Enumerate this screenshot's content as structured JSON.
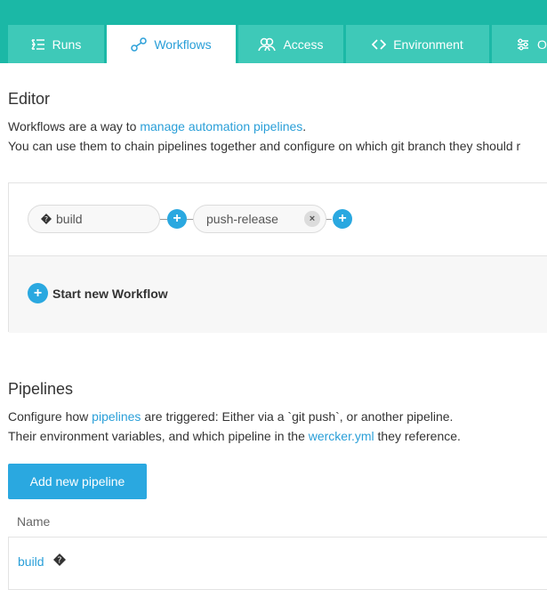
{
  "tabs": [
    {
      "label": "Runs",
      "icon": "runs-icon"
    },
    {
      "label": "Workflows",
      "icon": "workflows-icon",
      "active": true
    },
    {
      "label": "Access",
      "icon": "access-icon"
    },
    {
      "label": "Environment",
      "icon": "code-icon"
    },
    {
      "label": "O",
      "icon": "options-icon"
    }
  ],
  "editor": {
    "title": "Editor",
    "desc1_prefix": "Workflows are a way to ",
    "desc1_link": "manage automation pipelines",
    "desc1_suffix": ".",
    "desc2": "You can use them to chain pipelines together and configure on which git branch they should r"
  },
  "workflow": {
    "nodes": [
      {
        "label": "build",
        "icon": "git-branch-icon"
      },
      {
        "label": "push-release"
      }
    ],
    "remove_glyph": "×",
    "add_glyph": "+",
    "start_new_label": "Start new Workflow"
  },
  "pipelines": {
    "title": "Pipelines",
    "desc1_prefix": "Configure how ",
    "desc1_link": "pipelines",
    "desc1_suffix": " are triggered: Either via a `git push`, or another pipeline.",
    "desc2_prefix": "Their environment variables, and which pipeline in the ",
    "desc2_link": "wercker.yml",
    "desc2_suffix": " they reference.",
    "add_button": "Add new pipeline",
    "table": {
      "column_name": "Name",
      "rows": [
        {
          "name": "build",
          "icon": "git-branch-icon"
        }
      ]
    }
  },
  "colors": {
    "topbar": "#1bb8a6",
    "tab": "#3ec9b8",
    "accent": "#2aa8e0",
    "link": "#2a9fd8"
  }
}
